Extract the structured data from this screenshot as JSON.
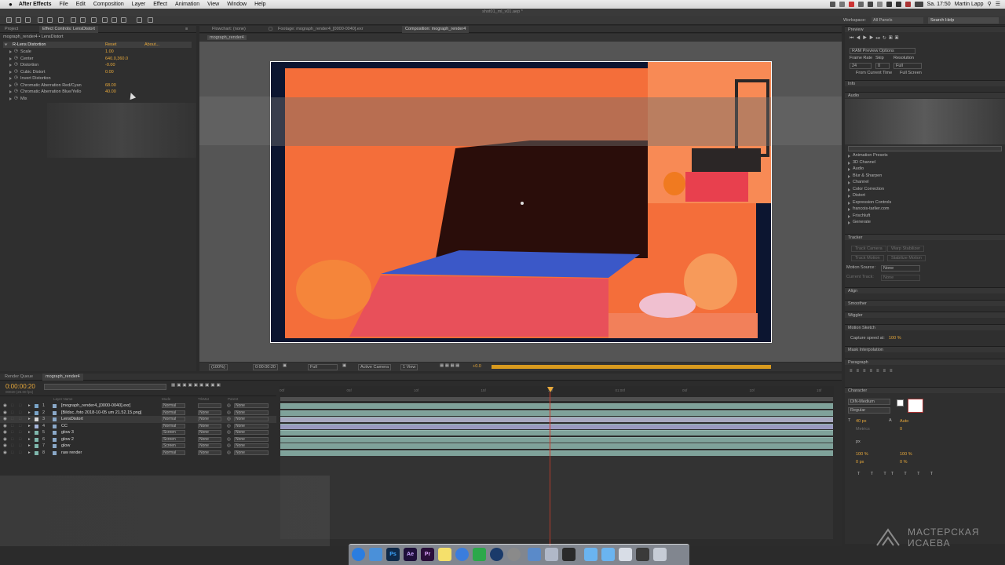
{
  "menubar": {
    "app_name": "After Effects",
    "items": [
      "File",
      "Edit",
      "Composition",
      "Layer",
      "Effect",
      "Animation",
      "View",
      "Window",
      "Help"
    ],
    "clock": "Sa. 17:50",
    "user": "Martin Lapp"
  },
  "window_title": "shot01_ml_v01.aep *",
  "workspace": {
    "label": "Workspace:",
    "value": "All Panels",
    "search_placeholder": "Search Help"
  },
  "left_panel": {
    "tabs": [
      "Project",
      "Effect Controls: LensDistort"
    ],
    "subtitle": "mograph_render4 • LensDistort",
    "effect_name": "R-Lens Distortion",
    "reset": "Reset",
    "about": "About...",
    "properties": [
      {
        "name": "Scale",
        "value": "1.00"
      },
      {
        "name": "Center",
        "value": "640.0,360.0"
      },
      {
        "name": "Distortion",
        "value": "-0.00"
      },
      {
        "name": "Cubic Distort",
        "value": "0.00"
      },
      {
        "name": "Invert Distortion",
        "value": ""
      },
      {
        "name": "Chromatic Aberration Red/Cyan",
        "value": "68.00"
      },
      {
        "name": "Chromatic Aberration Blue/Yello",
        "value": "40.00"
      },
      {
        "name": "Mix",
        "value": ""
      }
    ]
  },
  "viewer": {
    "tabs": [
      "Flowchart: (none)",
      "Footage: mograph_render4_[0000-0040].exr",
      "Composition: mograph_render4"
    ],
    "breadcrumb": "mograph_render4",
    "footer": {
      "zoom": "(100%)",
      "timecode": "0:00:00:20",
      "resolution": "Full",
      "camera": "Active Camera",
      "views": "1 View",
      "exposure": "+0.0"
    }
  },
  "timeline": {
    "tabs": [
      "Render Queue",
      "mograph_render4"
    ],
    "timecode": "0:00:00:20",
    "timecode_sub": "00020 (25.00 fps)",
    "columns": {
      "layer_name": "Layer Name",
      "mode": "Mode",
      "trkmat": "TrkMat",
      "parent": "Parent"
    },
    "ruler": [
      "00f",
      "05f",
      "10f",
      "15f",
      "20f",
      "01:00f",
      "05f",
      "10f",
      "15f"
    ],
    "layers": [
      {
        "num": "1",
        "name": "[mograph_render4_[0000-0040].exr]",
        "mode": "Normal",
        "trkmat": "",
        "parent": "None",
        "color": "#7aa5c9"
      },
      {
        "num": "2",
        "name": "[Bildsc..foto 2018-10-05 um 21.52.15.png]",
        "mode": "Normal",
        "trkmat": "None",
        "parent": "None",
        "color": "#7aa5c9"
      },
      {
        "num": "3",
        "name": "LensDistort",
        "mode": "Normal",
        "trkmat": "None",
        "parent": "None",
        "color": "#d9d9d9"
      },
      {
        "num": "4",
        "name": "CC",
        "mode": "Normal",
        "trkmat": "None",
        "parent": "None",
        "color": "#a4b4d9"
      },
      {
        "num": "5",
        "name": "glow 3",
        "mode": "Screen",
        "trkmat": "None",
        "parent": "None",
        "color": "#7fb8ad"
      },
      {
        "num": "6",
        "name": "glow 2",
        "mode": "Screen",
        "trkmat": "None",
        "parent": "None",
        "color": "#7fb8ad"
      },
      {
        "num": "7",
        "name": "glow",
        "mode": "Screen",
        "trkmat": "None",
        "parent": "None",
        "color": "#7fb8ad"
      },
      {
        "num": "8",
        "name": "raw render",
        "mode": "Normal",
        "trkmat": "None",
        "parent": "None",
        "color": "#7fb8ad"
      }
    ]
  },
  "right_panels": {
    "preview": {
      "title": "Preview",
      "ram_options": "RAM Preview Options",
      "frame_rate_label": "Frame Rate",
      "skip_label": "Skip",
      "resolution_label": "Resolution",
      "frame_rate": "24",
      "skip": "0",
      "resolution": "Full",
      "from_current": "From Current Time",
      "full_screen": "Full Screen"
    },
    "info": "Info",
    "audio": "Audio",
    "effects_list": [
      "Animation Presets",
      "3D Channel",
      "Audio",
      "Blur & Sharpen",
      "Channel",
      "Color Correction",
      "Distort",
      "Expression Controls",
      "francois-tarlier.com",
      "Frischluft",
      "Generate"
    ],
    "tracker": {
      "title": "Tracker",
      "track_camera": "Track Camera",
      "warp_stabilizer": "Warp Stabilizer",
      "track_motion": "Track Motion",
      "stabilize_motion": "Stabilize Motion",
      "motion_source_label": "Motion Source:",
      "motion_source": "None",
      "current_track_label": "Current Track:",
      "current_track": "None"
    },
    "align": "Align",
    "smoother": "Smoother",
    "wiggler": "Wiggler",
    "motion_sketch": {
      "title": "Motion Sketch",
      "capture_label": "Capture speed at:",
      "capture_value": "100 %"
    },
    "mask_interpolation": "Mask Interpolation",
    "paragraph": "Paragraph",
    "character": {
      "title": "Character",
      "font": "DIN-Medium",
      "style": "Regular",
      "size": "40 px",
      "leading": "Auto",
      "kerning": "Metrics",
      "tracking": "0",
      "stroke": "px",
      "vscale": "100 %",
      "hscale": "100 %",
      "baseline": "0 px",
      "tsume": "0 %"
    }
  },
  "watermark": {
    "line1": "МАСТЕРСКАЯ",
    "line2": "ИСАЕВА"
  },
  "colors": {
    "accent": "#e8a93b",
    "comp_orange": "#f46a3c",
    "timeline_track": "#7fa29a"
  }
}
